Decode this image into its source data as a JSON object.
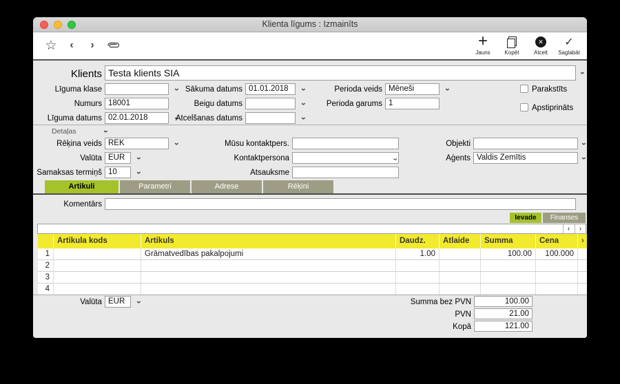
{
  "window": {
    "title": "Klienta līgums : Izmainīts"
  },
  "toolbar": {
    "actions": [
      {
        "id": "jauns",
        "label": "Jauns"
      },
      {
        "id": "kopet",
        "label": "Kopēt"
      },
      {
        "id": "atcelt",
        "label": "Atcelt"
      },
      {
        "id": "saglabat",
        "label": "Saglabāt"
      }
    ]
  },
  "form": {
    "klients": {
      "label": "Klients",
      "value": "Testa klients SIA"
    },
    "liguma_klase": {
      "label": "Līguma klase",
      "value": ""
    },
    "sakuma_datums": {
      "label": "Sākuma datums",
      "value": "01.01.2018"
    },
    "perioda_veids": {
      "label": "Perioda veids",
      "value": "Mēneši"
    },
    "parakstits": {
      "label": "Parakstīts",
      "checked": false
    },
    "numurs": {
      "label": "Numurs",
      "value": "18001"
    },
    "beigu_datums": {
      "label": "Beigu datums",
      "value": ""
    },
    "perioda_garums": {
      "label": "Perioda garums",
      "value": "1"
    },
    "apstiprinats": {
      "label": "Apstiprināts",
      "checked": false
    },
    "liguma_datums": {
      "label": "Līguma datums",
      "value": "02.01.2018"
    },
    "atcelsanas_datums": {
      "label": "Atcelšanas datums",
      "value": ""
    }
  },
  "detalas": {
    "section_label": "Detaļas",
    "rekina_veids": {
      "label": "Rēķina veids",
      "value": "REK"
    },
    "musu_kontaktpers": {
      "label": "Mūsu kontaktpers.",
      "value": ""
    },
    "objekti": {
      "label": "Objekti",
      "value": ""
    },
    "valuta": {
      "label": "Valūta",
      "value": "EUR"
    },
    "kontaktpersona": {
      "label": "Kontaktpersona",
      "value": ""
    },
    "agents": {
      "label": "Aģents",
      "value": "Valdis Zemītis"
    },
    "samaksas_termins": {
      "label": "Samaksas termiņš",
      "value": "10"
    },
    "atsauksme": {
      "label": "Atsauksme",
      "value": ""
    }
  },
  "tabs": [
    {
      "label": "Artikuli",
      "active": true
    },
    {
      "label": "Parametri",
      "active": false
    },
    {
      "label": "Adrese",
      "active": false
    },
    {
      "label": "Rēķini",
      "active": false
    }
  ],
  "komentars": {
    "label": "Komentārs",
    "value": ""
  },
  "view_buttons": [
    {
      "label": "Ievade",
      "active": true
    },
    {
      "label": "Finanses",
      "active": false
    }
  ],
  "table": {
    "columns": [
      "Artikula kods",
      "Artikuls",
      "Daudz.",
      "Atlaide",
      "Summa",
      "Cena"
    ],
    "rows": [
      {
        "num": "1",
        "kods": "",
        "artikuls": "Grāmatvedības pakalpojumi",
        "daudz": "1.00",
        "atlaide": "",
        "summa": "100.00",
        "cena": "100.000"
      },
      {
        "num": "2",
        "kods": "",
        "artikuls": "",
        "daudz": "",
        "atlaide": "",
        "summa": "",
        "cena": ""
      },
      {
        "num": "3",
        "kods": "",
        "artikuls": "",
        "daudz": "",
        "atlaide": "",
        "summa": "",
        "cena": ""
      },
      {
        "num": "4",
        "kods": "",
        "artikuls": "",
        "daudz": "",
        "atlaide": "",
        "summa": "",
        "cena": ""
      }
    ]
  },
  "footer": {
    "valuta": {
      "label": "Valūta",
      "value": "EUR"
    },
    "summa_bez_pvn": {
      "label": "Summa bez PVN",
      "value": "100.00"
    },
    "pvn": {
      "label": "PVN",
      "value": "21.00"
    },
    "kopa": {
      "label": "Kopā",
      "value": "121.00"
    }
  },
  "colors": {
    "accent_green": "#a5c22b",
    "inactive_tab": "#9d9d85",
    "table_header_yellow": "#f2ea2e"
  }
}
